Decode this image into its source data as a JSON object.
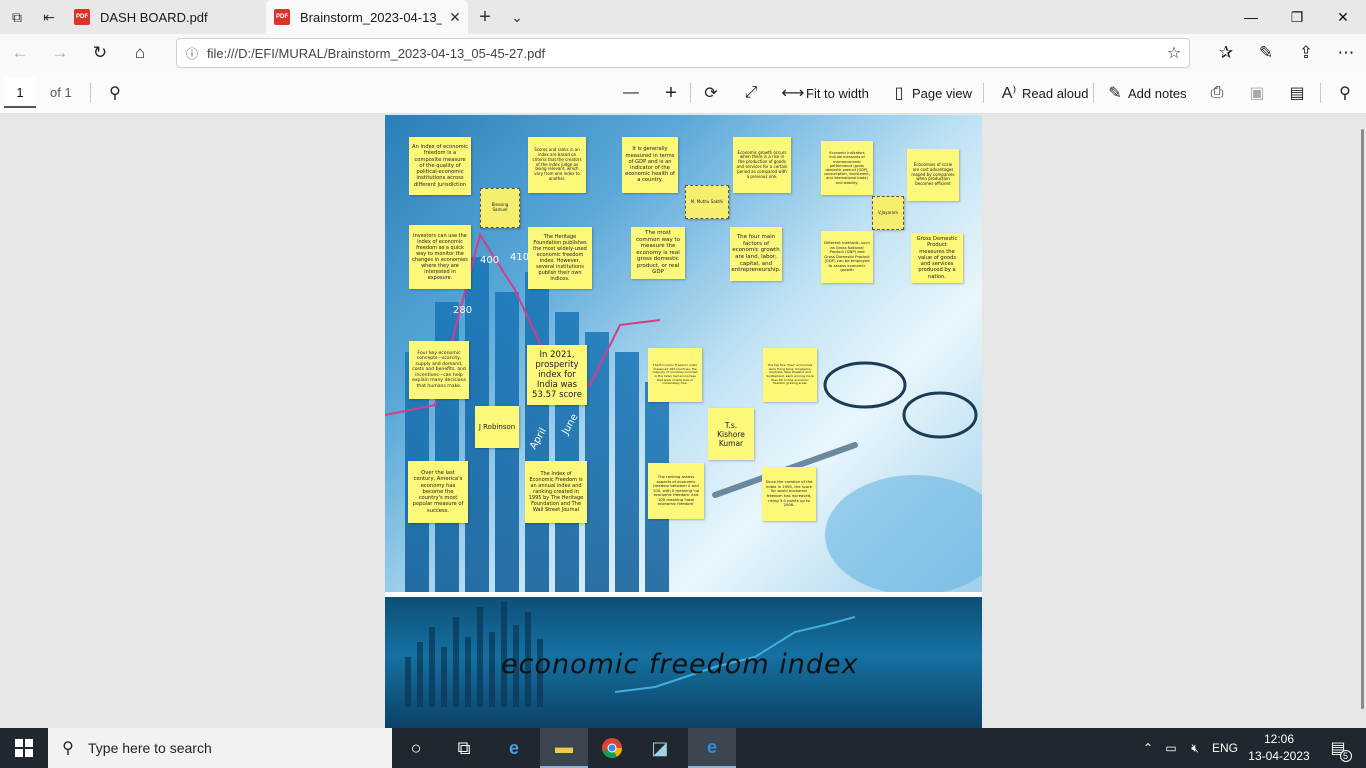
{
  "browser": {
    "tabs": [
      {
        "label": "DASH BOARD.pdf",
        "active": false
      },
      {
        "label": "Brainstorm_2023-04-13_",
        "active": true
      }
    ],
    "url": "file:///D:/EFI/MURAL/Brainstorm_2023-04-13_05-45-27.pdf"
  },
  "pdf_toolbar": {
    "page_current": "1",
    "page_total": "of 1",
    "fit_to_width": "Fit to width",
    "page_view": "Page view",
    "read_aloud": "Read aloud",
    "add_notes": "Add notes"
  },
  "mural": {
    "chart_labels": [
      "400",
      "410",
      "280",
      "April",
      "June"
    ],
    "title": "economic freedom index",
    "notes": [
      {
        "id": "n1",
        "text": "An index of economic freedom is a composite measure of the quality of political-economic institutions across different jurisdiction"
      },
      {
        "id": "n2",
        "text": "Scores and ranks in an index are based on criteria that the creators of the index judge as being relevant, which vary from one index to another."
      },
      {
        "id": "n3",
        "text": "It is generally measured in terms of GDP and is an indicator of the economic health of a country."
      },
      {
        "id": "n4",
        "text": "Economic growth occurs when there is a rise in the production of goods and services for a certain period as compared with a previous one."
      },
      {
        "id": "n5",
        "text": "Economic indicators include measures of macroeconomic performance (gross domestic product [GDP], consumption, investment, and international trade) and stability."
      },
      {
        "id": "n6",
        "text": "Economies of scale are cost advantages reaped by companies when production becomes efficient"
      },
      {
        "id": "n7",
        "text": "Blessing Samuel"
      },
      {
        "id": "n8",
        "text": "M. Muthu Sakthi"
      },
      {
        "id": "n9",
        "text": "V.Jayaram"
      },
      {
        "id": "n10",
        "text": "Investors can use the index of economic freedom as a quick way to monitor the changes in economies where they are interested in exposure."
      },
      {
        "id": "n11",
        "text": "The Heritage Foundation publishes the most widely-used economic freedom index. However, several institutions publish their own indices."
      },
      {
        "id": "n12",
        "text": "The most common way to measure the economy is real gross domestic product, or real GDP"
      },
      {
        "id": "n13",
        "text": "The four main factors of economic growth are land, labor, capital, and entrepreneurship."
      },
      {
        "id": "n14",
        "text": "Different methods, such as Gross National Product (GNP) and Gross Domestic Product (GDP) can be employed to assess economic growth"
      },
      {
        "id": "n15",
        "text": "Gross Domestic Product measures the value of goods and services produced by a nation."
      },
      {
        "id": "n16",
        "text": "Four key economic concepts—scarcity, supply and demand, costs and benefits, and incentives—can help explain many decisions that humans make."
      },
      {
        "id": "n17",
        "text": "In 2021, prosperity index for India was 53.57 score"
      },
      {
        "id": "n18",
        "text": "The Economic Freedom index measured 184 countries; the majority of countries included in the index had economies that were mostly free or moderately free."
      },
      {
        "id": "n19",
        "text": "The top five \"free\" economies were Hong Kong, Singapore, Australia, New Zealand and Switzerland, each scoring more than 80 on the economic freedom grading scale."
      },
      {
        "id": "n20",
        "text": "J Robinson"
      },
      {
        "id": "n21",
        "text": "T.s. Kishore Kumar"
      },
      {
        "id": "n22",
        "text": "Over the last century, America's economy has become the country's most popular measure of success."
      },
      {
        "id": "n23",
        "text": "The Index of Economic Freedom is an annual index and ranking created in 1995 by The Heritage Foundation and The Wall Street Journal"
      },
      {
        "id": "n24",
        "text": "The ranking assess aspects of economic freedom between 0 and 100, with 0 meaning 'no economic freedom' and 100 meaning 'total economic freedom'"
      },
      {
        "id": "n25",
        "text": "Since the creation of the index in 1995, the score for world economic freedom has increased, rising 3.0 points up to 2008."
      }
    ]
  },
  "taskbar": {
    "search_placeholder": "Type here to search",
    "language": "ENG",
    "time": "12:06",
    "date": "13-04-2023",
    "notification_count": "5"
  }
}
